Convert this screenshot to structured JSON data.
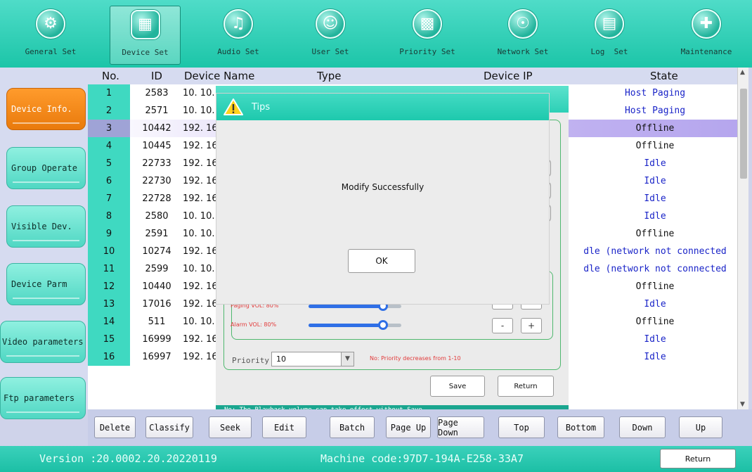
{
  "nav": {
    "items": [
      {
        "label": "General Set",
        "icon": "gear-icon"
      },
      {
        "label": "Device Set",
        "icon": "grid-icon",
        "active": true
      },
      {
        "label": "Audio Set",
        "icon": "music-note-icon"
      },
      {
        "label": "User Set",
        "icon": "user-icon"
      },
      {
        "label": "Priority Set",
        "icon": "bar-chart-icon"
      },
      {
        "label": "Network Set",
        "icon": "globe-icon"
      },
      {
        "label": "Log  Set",
        "icon": "folder-icon"
      },
      {
        "label": "Maintenance",
        "icon": "wrench-icon"
      }
    ]
  },
  "sidebar": {
    "items": [
      {
        "label": "Device Info.",
        "active": true
      },
      {
        "label": "Group Operate"
      },
      {
        "label": "Visible Dev."
      },
      {
        "label": "Device Parm"
      },
      {
        "label": "Video parameters"
      },
      {
        "label": "Ftp parameters"
      }
    ]
  },
  "table": {
    "headers": {
      "no": "No.",
      "id": "ID",
      "name": "Device Name",
      "type": "Type",
      "ip": "Device IP",
      "state": "State"
    },
    "rows": [
      {
        "no": "1",
        "id": "2583",
        "name": "10. 10.",
        "state": "Host Paging"
      },
      {
        "no": "2",
        "id": "2571",
        "name": "10. 10.",
        "state": "Host Paging"
      },
      {
        "no": "3",
        "id": "10442",
        "name": "192. 16",
        "state": "Offline",
        "selected": true
      },
      {
        "no": "4",
        "id": "10445",
        "name": "192. 16",
        "state": "Offline"
      },
      {
        "no": "5",
        "id": "22733",
        "name": "192. 16",
        "state": "Idle"
      },
      {
        "no": "6",
        "id": "22730",
        "name": "192. 16",
        "state": "Idle"
      },
      {
        "no": "7",
        "id": "22728",
        "name": "192. 16",
        "state": "Idle"
      },
      {
        "no": "8",
        "id": "2580",
        "name": "10. 10.",
        "state": "Idle"
      },
      {
        "no": "9",
        "id": "2591",
        "name": "10. 10.",
        "state": "Offline"
      },
      {
        "no": "10",
        "id": "10274",
        "name": "192. 16",
        "state": "dle (network not connected"
      },
      {
        "no": "11",
        "id": "2599",
        "name": "10. 10.",
        "state": "dle (network not connected"
      },
      {
        "no": "12",
        "id": "10440",
        "name": "192. 16",
        "state": "Offline"
      },
      {
        "no": "13",
        "id": "17016",
        "name": "192. 16",
        "state": "Idle"
      },
      {
        "no": "14",
        "id": "511",
        "name": "10. 10.",
        "state": "Offline"
      },
      {
        "no": "15",
        "id": "16999",
        "name": "192. 16",
        "state": "Idle"
      },
      {
        "no": "16",
        "id": "16997",
        "name": "192. 16",
        "state": "Idle"
      }
    ]
  },
  "toolbar": {
    "buttons": [
      "Delete",
      "Classify",
      "Seek",
      "Edit",
      "Batch",
      "Page Up",
      "Page Down",
      "Top",
      "Bottom",
      "Down",
      "Up"
    ]
  },
  "status": {
    "version": "Version :20.0002.20.20220119",
    "machine_code": "Machine code:97D7-194A-E258-33A7",
    "return_label": "Return"
  },
  "edit_dialog": {
    "paging_vol_label": "Paging VOL:  80%",
    "paging_vol": 0.8,
    "alarm_vol_label": "Alarm  VOL:  80%",
    "alarm_vol": 0.8,
    "minus": "-",
    "plus": "+",
    "priority_label": "Priority",
    "priority_value": "10",
    "priority_note": "No: Priority decreases from 1-10",
    "save_label": "Save",
    "return_label": "Return",
    "playback_note": "No: The Playback volume can take effect without Save"
  },
  "tips": {
    "title": "Tips",
    "message": "Modify Successfully",
    "ok_label": "OK"
  },
  "colors": {
    "accent": "#2dd0b6",
    "active_sidebar": "#f08a1c",
    "state_blue": "#1a24c8"
  }
}
